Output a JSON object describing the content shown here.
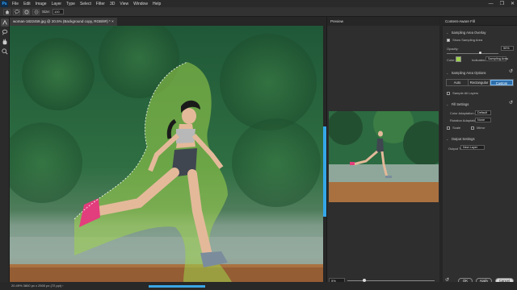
{
  "app": {
    "logo": "Ps",
    "window_controls": [
      "—",
      "❐",
      "✕"
    ]
  },
  "menu": [
    "File",
    "Edit",
    "Image",
    "Layer",
    "Type",
    "Select",
    "Filter",
    "3D",
    "View",
    "Window",
    "Help"
  ],
  "options_bar": {
    "home_icon": "home-icon",
    "size_label": "Size:",
    "size_value": "100"
  },
  "document": {
    "tab_title": "woman-1822459.jpg @ 20.5% (Background copy, RGB/8#) *",
    "close_glyph": "×"
  },
  "tools": [
    "lasso-icon",
    "lasso-alt-icon",
    "hand-icon",
    "zoom-icon"
  ],
  "status": {
    "text": "20.49%   3800 px x 2500 px (72 ppi)  ›"
  },
  "preview": {
    "title": "Preview",
    "zoom_value": "5%",
    "zoom_level": 0.18
  },
  "panel": {
    "title": "Content-Aware Fill",
    "sampling_overlay": {
      "header": "Sampling Area Overlay",
      "show_label": "Show Sampling Area",
      "opacity_label": "Opacity:",
      "opacity_value": "50%",
      "color_label": "Color:",
      "color_hex": "#9ed34b",
      "indicates_label": "Indicates:",
      "indicates_value": "Sampling Area"
    },
    "sampling_options": {
      "header": "Sampling Area Options",
      "modes": [
        "Auto",
        "Rectangular",
        "Custom"
      ],
      "active_mode": "Custom",
      "sample_all_layers": "Sample All Layers"
    },
    "fill_settings": {
      "header": "Fill Settings",
      "color_adaptation_label": "Color Adaptation:",
      "color_adaptation_value": "Default",
      "rotation_adaptation_label": "Rotation Adaptation:",
      "rotation_adaptation_value": "None",
      "scale_label": "Scale",
      "mirror_label": "Mirror"
    },
    "output": {
      "header": "Output Settings",
      "output_to_label": "Output To:",
      "output_to_value": "New Layer"
    },
    "buttons": {
      "ok": "OK",
      "apply": "Apply",
      "cancel": "Cancel"
    }
  }
}
